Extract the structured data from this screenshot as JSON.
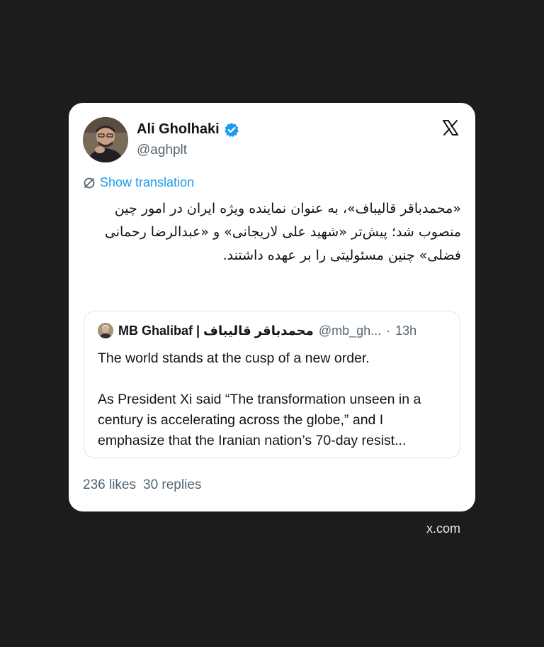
{
  "author": {
    "name": "Ali Gholhaki",
    "handle": "@aghplt",
    "verified": true
  },
  "translate_label": "Show translation",
  "post_text": "«محمدباقر قالیباف»، به عنوان نماینده ویژه ایران در امور چین منصوب شد؛ پیش‌تر «شهید علی لاریجانی» و «عبدالرضا رحمانی فضلی» چنین مسئولیتی را بر عهده داشتند.",
  "quoted_post": {
    "name": "MB Ghalibaf | محمدباقر قالیباف",
    "handle": "@mb_gh...",
    "separator": "·",
    "time": "13h",
    "paragraph_1": "The world stands at the cusp of a new order.",
    "paragraph_2": "As President Xi said “The transformation unseen in a century is accelerating across the globe,” and I emphasize that the Iranian nation’s 70-day resist..."
  },
  "stats": {
    "likes": "236 likes",
    "replies": "30 replies"
  },
  "footer_domain": "x.com",
  "colors": {
    "background": "#1c1c1c",
    "card": "#ffffff",
    "link": "#1d9bf0",
    "verified_badge": "#1d9bf0",
    "muted_text": "#536471"
  },
  "icons": {
    "verified": "verified-badge-icon",
    "brand": "x-logo-icon",
    "translate": "translate-icon"
  }
}
